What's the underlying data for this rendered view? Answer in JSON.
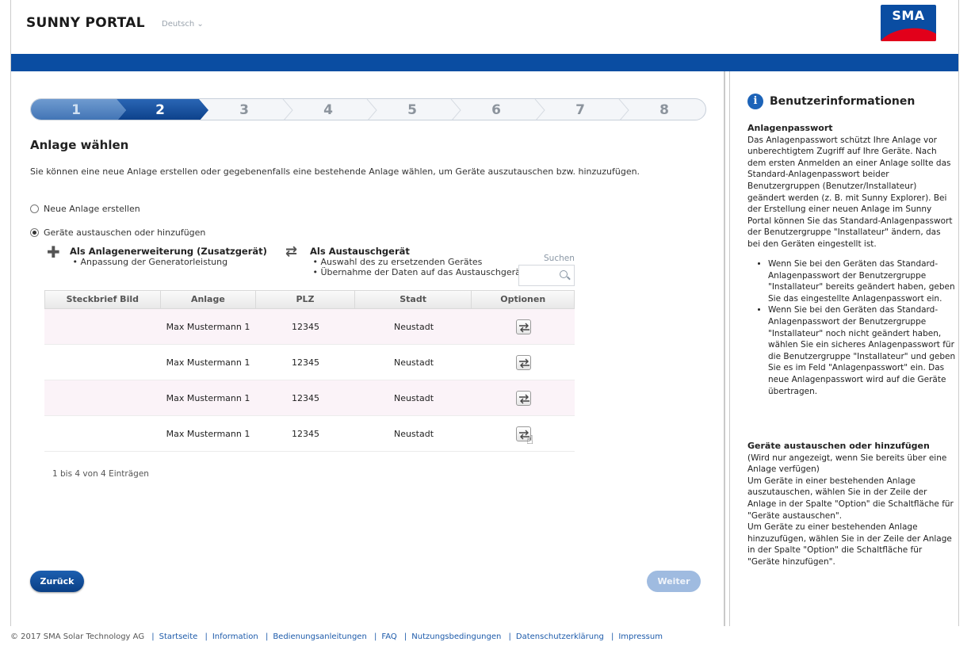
{
  "header": {
    "brand": "SUNNY PORTAL",
    "language": "Deutsch",
    "logo_text": "SMA",
    "colors": {
      "primary_blue": "#0a4da2",
      "logo_red": "#e2001a"
    }
  },
  "stepper": {
    "steps": [
      "1",
      "2",
      "3",
      "4",
      "5",
      "6",
      "7",
      "8"
    ],
    "completed_until": 2
  },
  "main": {
    "title": "Anlage wählen",
    "intro": "Sie können eine neue Anlage erstellen oder gegebenenfalls eine bestehende Anlage wählen, um Geräte auszutauschen bzw. hinzuzufügen.",
    "radio_new": "Neue Anlage erstellen",
    "radio_replace": "Geräte austauschen oder hinzufügen",
    "option_extension": {
      "title": "Als Anlagenerweiterung (Zusatzgerät)",
      "bullets": [
        "Anpassung der Generatorleistung"
      ]
    },
    "option_replacement": {
      "title": "Als Austauschgerät",
      "bullets": [
        "Auswahl des zu ersetzenden Gerätes",
        "Übernahme der Daten auf das Austauschgerät"
      ]
    },
    "search_label": "Suchen",
    "search_placeholder": "",
    "table": {
      "headers": [
        "Steckbrief Bild",
        "Anlage",
        "PLZ",
        "Stadt",
        "Optionen"
      ],
      "rows": [
        {
          "bild": "",
          "anlage": "Max Mustermann 1",
          "plz": "12345",
          "stadt": "Neustadt"
        },
        {
          "bild": "",
          "anlage": "Max Mustermann 1",
          "plz": "12345",
          "stadt": "Neustadt"
        },
        {
          "bild": "",
          "anlage": "Max Mustermann 1",
          "plz": "12345",
          "stadt": "Neustadt"
        },
        {
          "bild": "",
          "anlage": "Max Mustermann 1",
          "plz": "12345",
          "stadt": "Neustadt"
        }
      ]
    },
    "entries_info": "1 bis 4 von 4 Einträgen",
    "back_label": "Zurück",
    "next_label": "Weiter"
  },
  "sidebar": {
    "title": "Benutzerinformationen",
    "section1_title": "Anlagenpasswort",
    "section1_text": "Das Anlagenpasswort schützt Ihre Anlage vor unberechtigtem Zugriff auf Ihre Geräte. Nach dem ersten Anmelden an einer Anlage sollte das Standard-Anlagenpasswort beider Benutzergruppen (Benutzer/Installateur) geändert werden (z. B. mit Sunny Explorer). Bei der Erstellung einer neuen Anlage im Sunny Portal können Sie das Standard-Anlagenpasswort der Benutzergruppe \"Installateur\" ändern, das bei den Geräten eingestellt ist.",
    "bullets": [
      "Wenn Sie bei den Geräten das Standard-Anlagenpasswort der Benutzergruppe \"Installateur\" bereits geändert haben, geben Sie das eingestellte Anlagenpasswort ein.",
      "Wenn Sie bei den Geräten das Standard-Anlagenpasswort der Benutzergruppe \"Installateur\" noch nicht geändert haben, wählen Sie ein sicheres Anlagenpasswort für die Benutzergruppe \"Installateur\" und geben Sie es im Feld \"Anlagenpasswort\" ein. Das neue Anlagenpasswort wird auf die Geräte übertragen."
    ],
    "section2_title": "Geräte austauschen oder hinzufügen",
    "section2_lines": [
      "(Wird nur angezeigt, wenn Sie bereits über eine Anlage verfügen)",
      "Um Geräte in einer bestehenden Anlage auszutauschen, wählen Sie in der Zeile der Anlage in der Spalte \"Option\" die Schaltfläche für \"Geräte austauschen\".",
      "Um Geräte zu einer bestehenden Anlage hinzuzufügen, wählen Sie in der Zeile der Anlage in der Spalte \"Option\" die Schaltfläche für \"Geräte hinzufügen\"."
    ]
  },
  "footer": {
    "copyright": "© 2017 SMA Solar Technology AG",
    "links": [
      "Startseite",
      "Information",
      "Bedienungsanleitungen",
      "FAQ",
      "Nutzungsbedingungen",
      "Datenschutzerklärung",
      "Impressum"
    ]
  }
}
